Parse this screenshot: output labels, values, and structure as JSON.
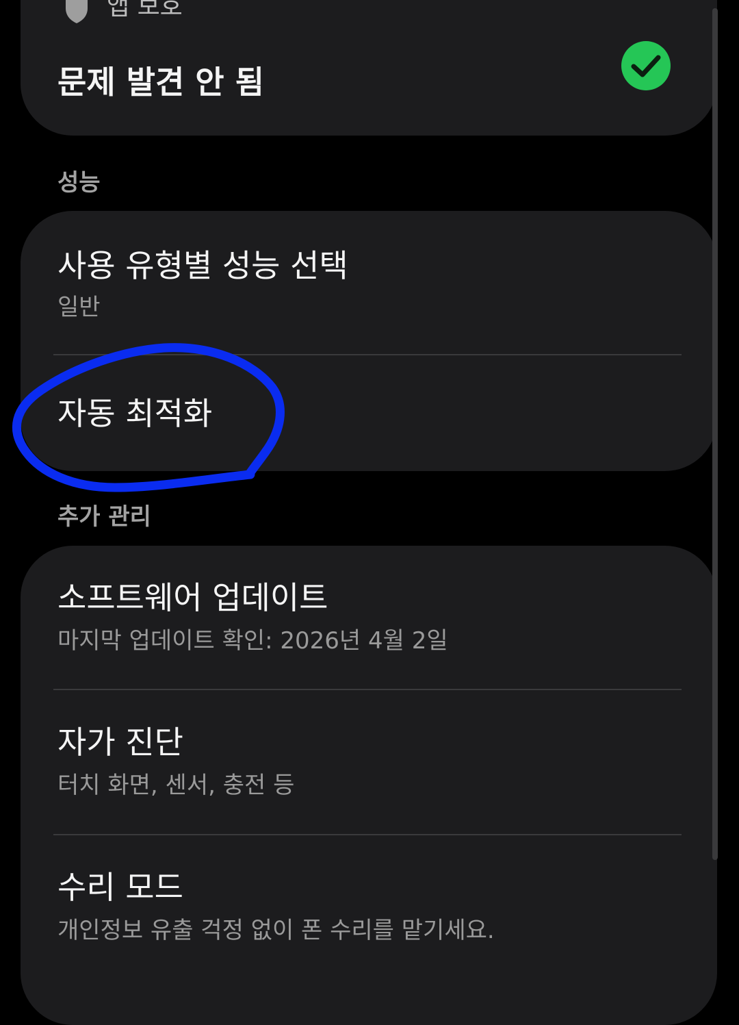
{
  "app_protection": {
    "label": "앱 보호",
    "status": "문제 발견 안 됨",
    "status_color": "#25c656"
  },
  "performance": {
    "section_label": "성능",
    "items": [
      {
        "title": "사용 유형별 성능 선택",
        "subtitle": "일반"
      },
      {
        "title": "자동 최적화"
      }
    ]
  },
  "additional": {
    "section_label": "추가 관리",
    "items": [
      {
        "title": "소프트웨어 업데이트",
        "subtitle": "마지막 업데이트 확인: 2026년 4월 2일"
      },
      {
        "title": "자가 진단",
        "subtitle": "터치 화면, 센서, 충전 등"
      },
      {
        "title": "수리 모드",
        "subtitle": "개인정보 유출 걱정 없이 폰 수리를 맡기세요."
      }
    ]
  },
  "colors": {
    "background": "#000000",
    "card": "#1c1c1e",
    "annotation": "#0a2cf0"
  }
}
